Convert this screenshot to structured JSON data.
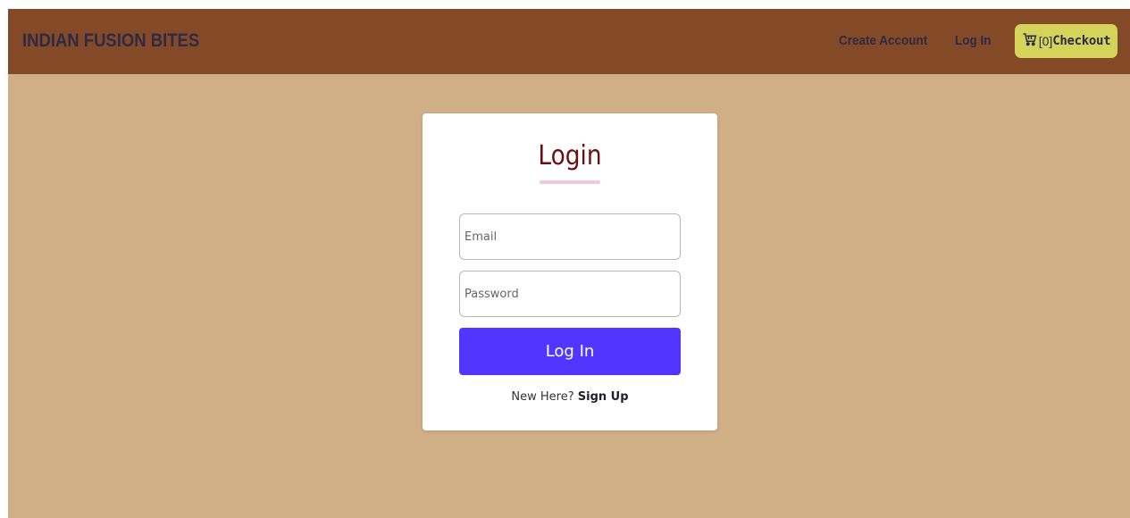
{
  "navbar": {
    "brand": "INDIAN FUSION BITES",
    "links": {
      "create_account": "Create Account",
      "log_in": "Log In"
    },
    "cart": {
      "count_text": "[0]",
      "checkout_label": "Checkout",
      "icon": "cart-icon"
    }
  },
  "login_card": {
    "title": "Login",
    "email": {
      "placeholder": "Email",
      "value": ""
    },
    "password": {
      "placeholder": "Password",
      "value": ""
    },
    "submit_label": "Log In",
    "signup_prompt": "New Here?",
    "signup_link": "Sign Up"
  },
  "colors": {
    "navbar_bg": "#844a28",
    "page_bg": "#d0af86",
    "checkout_bg": "#d4d45a",
    "button_bg": "#5236ff",
    "title_color": "#6b0f12",
    "underline_color": "#f0c8de"
  }
}
